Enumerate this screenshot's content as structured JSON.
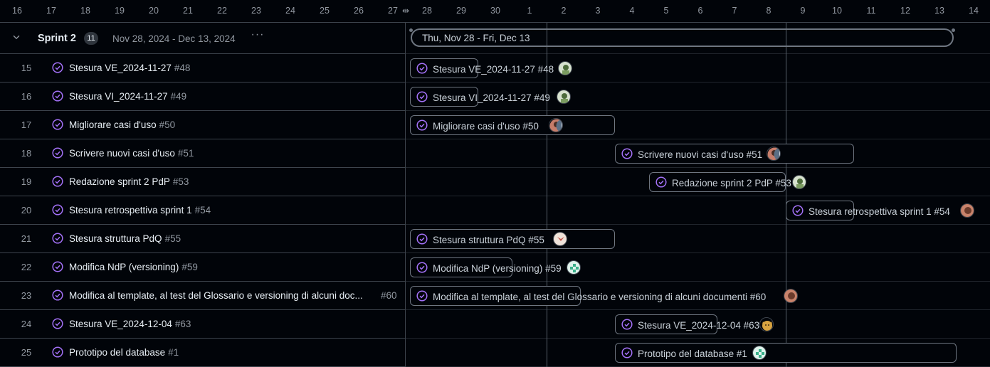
{
  "timeline": {
    "ticks": [
      "16",
      "17",
      "18",
      "19",
      "20",
      "21",
      "22",
      "23",
      "24",
      "25",
      "26",
      "27",
      "28",
      "29",
      "30",
      "1",
      "2",
      "3",
      "4",
      "5",
      "6",
      "7",
      "8",
      "9",
      "10",
      "11",
      "12",
      "13",
      "14"
    ]
  },
  "group": {
    "title": "Sprint 2",
    "count": "11",
    "date_range": "Nov 28, 2024 - Dec 13, 2024",
    "more": "···",
    "bar_label": "Thu, Nov 28 - Fri, Dec 13"
  },
  "rows": [
    {
      "num": "15",
      "title": "Stesura VE_2024-11-27",
      "issue": "#48",
      "bar": "Stesura VE_2024-11-27 #48"
    },
    {
      "num": "16",
      "title": "Stesura VI_2024-11-27",
      "issue": "#49",
      "bar": "Stesura VI_2024-11-27 #49"
    },
    {
      "num": "17",
      "title": "Migliorare casi d'uso",
      "issue": "#50",
      "bar": "Migliorare casi d'uso #50"
    },
    {
      "num": "18",
      "title": "Scrivere nuovi casi d'uso",
      "issue": "#51",
      "bar": "Scrivere nuovi casi d'uso #51"
    },
    {
      "num": "19",
      "title": "Redazione sprint 2 PdP",
      "issue": "#53",
      "bar": "Redazione sprint 2 PdP #53"
    },
    {
      "num": "20",
      "title": "Stesura retrospettiva sprint 1",
      "issue": "#54",
      "bar": "Stesura retrospettiva sprint 1 #54"
    },
    {
      "num": "21",
      "title": "Stesura struttura PdQ",
      "issue": "#55",
      "bar": "Stesura struttura PdQ #55"
    },
    {
      "num": "22",
      "title": "Modifica NdP (versioning)",
      "issue": "#59",
      "bar": "Modifica NdP (versioning) #59"
    },
    {
      "num": "23",
      "title": "Modifica al template, al test del Glossario e versioning di alcuni doc...",
      "issue": "#60",
      "bar": "Modifica al template, al test del Glossario e versioning di alcuni documenti #60"
    },
    {
      "num": "24",
      "title": "Stesura VE_2024-12-04",
      "issue": "#63",
      "bar": "Stesura VE_2024-12-04 #63"
    },
    {
      "num": "25",
      "title": "Prototipo del database",
      "issue": "#1",
      "bar": "Prototipo del database #1"
    }
  ],
  "colors": {
    "accent_purple": "#a371f7",
    "border": "#3d444d",
    "background": "#010409",
    "muted_text": "#9198a1"
  }
}
